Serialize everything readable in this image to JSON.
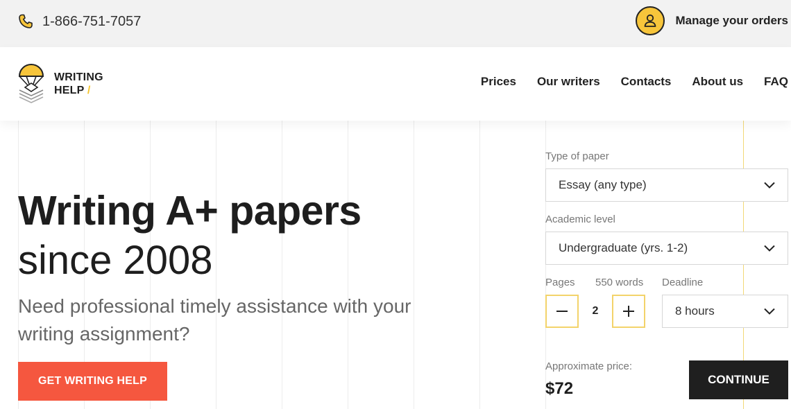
{
  "topbar": {
    "phone": "1-866-751-7057",
    "account_label": "Manage your orders"
  },
  "logo": {
    "line1": "WRITING",
    "line2": "HELP",
    "mark": "/"
  },
  "nav": {
    "items": [
      "Prices",
      "Our writers",
      "Contacts",
      "About us",
      "FAQ"
    ]
  },
  "hero": {
    "headline": "Writing A+ papers",
    "subheadline": "since 2008",
    "tagline": "Need professional timely assistance with your writing assignment?",
    "cta_label": "GET WRITING HELP"
  },
  "order_form": {
    "paper_type_label": "Type of paper",
    "paper_type_value": "Essay (any type)",
    "level_label": "Academic level",
    "level_value": "Undergraduate (yrs. 1-2)",
    "pages_label": "Pages",
    "words_label": "550 words",
    "deadline_label": "Deadline",
    "deadline_value": "8 hours",
    "pages_value": "2",
    "price_label": "Approximate price:",
    "price_value": "$72",
    "continue_label": "CONTINUE"
  },
  "icons": {
    "phone": "phone-icon",
    "account": "user-icon",
    "logo": "parachute-logo-icon",
    "chevron": "chevron-down-icon",
    "minus": "minus-icon",
    "plus": "plus-icon"
  },
  "colors": {
    "accent_yellow": "#f7c53b",
    "cta_red": "#f5573f",
    "dark": "#1f1f1f",
    "topbar_bg": "#f2f2f2"
  }
}
